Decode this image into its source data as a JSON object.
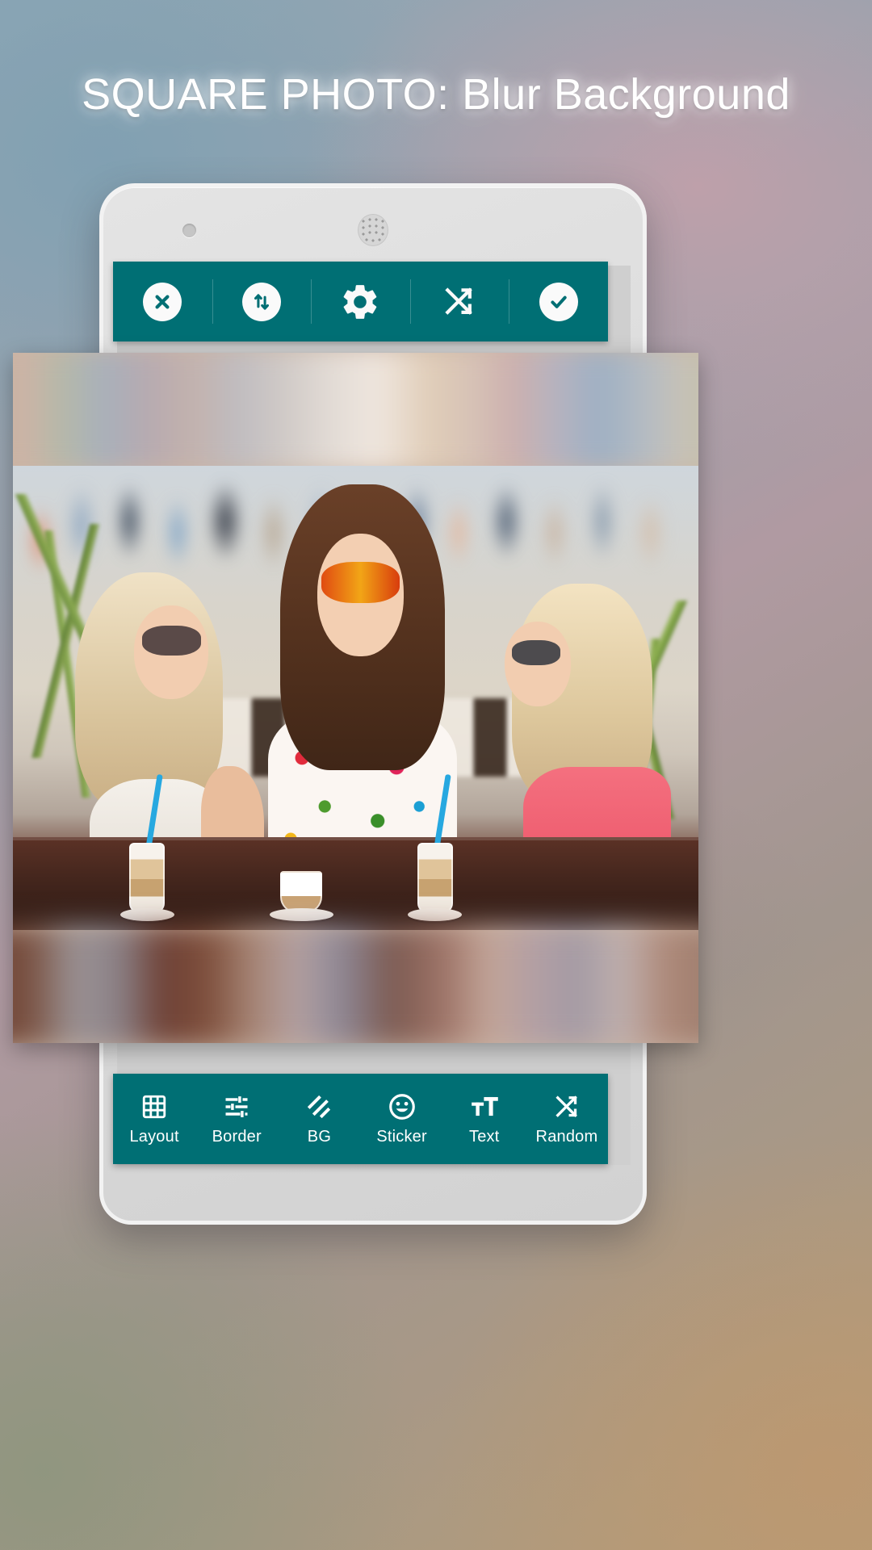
{
  "page": {
    "title": "SQUARE PHOTO: Blur Background",
    "accent_color": "#006f74",
    "title_color": "#ffffff"
  },
  "device": {
    "camera_icon": "camera-icon",
    "speaker_icon": "speaker-grille-icon"
  },
  "top_toolbar": {
    "background_color": "#006f74",
    "items": [
      {
        "name": "close",
        "icon": "close-circle-icon",
        "label": "Close"
      },
      {
        "name": "swap",
        "icon": "swap-vertical-circle-icon",
        "label": "Swap"
      },
      {
        "name": "settings",
        "icon": "gear-icon",
        "label": "Settings"
      },
      {
        "name": "shuffle",
        "icon": "shuffle-icon",
        "label": "Shuffle"
      },
      {
        "name": "confirm",
        "icon": "check-circle-icon",
        "label": "Done"
      }
    ]
  },
  "bottom_toolbar": {
    "background_color": "#006f74",
    "items": [
      {
        "label": "Layout",
        "icon": "grid-icon"
      },
      {
        "label": "Border",
        "icon": "sliders-icon"
      },
      {
        "label": "BG",
        "icon": "diagonal-stripes-icon"
      },
      {
        "label": "Sticker",
        "icon": "smiley-icon"
      },
      {
        "label": "Text",
        "icon": "text-size-icon"
      },
      {
        "label": "Random",
        "icon": "shuffle-icon"
      }
    ]
  },
  "canvas": {
    "name": "square-photo-preview",
    "description": "Three young women laughing at an outdoor cafe table with latte glasses",
    "blur_band_top": "blurred background fill",
    "blur_band_bottom": "blurred background fill"
  }
}
